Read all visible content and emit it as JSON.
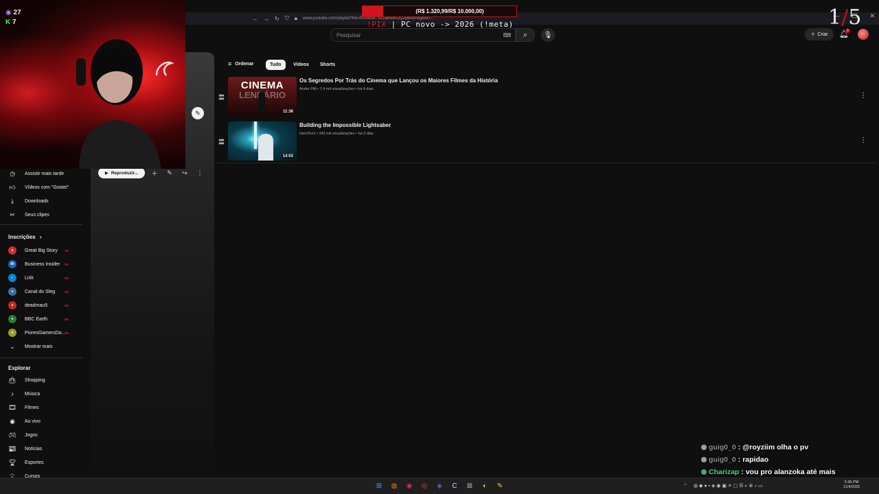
{
  "browser": {
    "url": "www.youtube.com/playlist?list=PLmiEw...cZ1avsuKOQZjwkWnxg8NU..."
  },
  "overlay": {
    "donation_text": "(R$ 1.320,99/R$ 10.000,00)",
    "pix_prefix": "!PIX",
    "pix_text": " | PC novo -> 2026 (!meta)",
    "counter_a": "1",
    "counter_b": "5",
    "viewer_count_a": "27",
    "viewer_count_b": "7"
  },
  "header": {
    "search_placeholder": "Pesquisar",
    "create_label": "Criar",
    "notifications_count": "9"
  },
  "filters": {
    "sort_label": "Ordenar",
    "chips": [
      "Tudo",
      "Vídeos",
      "Shorts"
    ]
  },
  "videos": [
    {
      "title": "Os Segredos Por Trás do Cinema que Lançou os Maiores Filmes da História",
      "meta": "Andre Pilli • 7,4 mil visualizações • há 4 dias",
      "duration": "11:36",
      "thumb_text": "CINEMA",
      "thumb_text2": "LENDÁRIO"
    },
    {
      "title": "Building the Impossible Lightsaber",
      "meta": "HeroTech • 342 mil visualizações • há 3 dias",
      "duration": "14:03"
    }
  ],
  "playlist": {
    "play_label": "Reproduzir..."
  },
  "sidebar": {
    "you_items": [
      {
        "label": "Assistir mais tarde",
        "icon": "clock-icon"
      },
      {
        "label": "Vídeos com \"Gostei\"",
        "icon": "thumbs-up-icon"
      },
      {
        "label": "Downloads",
        "icon": "download-icon"
      },
      {
        "label": "Seus clipes",
        "icon": "scissors-icon"
      }
    ],
    "subs_header": "Inscrições",
    "subscriptions": [
      {
        "label": "Great Big Story",
        "color": "#d32f2f",
        "initial": "●"
      },
      {
        "label": "Business Insider",
        "color": "#1565c0",
        "initial": "BI"
      },
      {
        "label": "Lirik",
        "color": "#0288d1",
        "initial": "◐"
      },
      {
        "label": "Canal do Sleg",
        "color": "#3d6fa8",
        "initial": "●"
      },
      {
        "label": "deadmau5",
        "color": "#c62828",
        "initial": "●"
      },
      {
        "label": "BBC Earth",
        "color": "#2e7d32",
        "initial": "●"
      },
      {
        "label": "PioresGamersDo...",
        "color": "#9e9d24",
        "initial": "●"
      }
    ],
    "show_more": "Mostrar mais",
    "explore_header": "Explorar",
    "explore": [
      {
        "label": "Shopping",
        "icon": "shopping-bag-icon"
      },
      {
        "label": "Música",
        "icon": "music-note-icon"
      },
      {
        "label": "Filmes",
        "icon": "film-icon"
      },
      {
        "label": "Ao vivo",
        "icon": "live-icon"
      },
      {
        "label": "Jogos",
        "icon": "gamepad-icon"
      },
      {
        "label": "Notícias",
        "icon": "news-icon"
      },
      {
        "label": "Esportes",
        "icon": "trophy-icon"
      },
      {
        "label": "Cursos",
        "icon": "lightbulb-icon"
      }
    ]
  },
  "chat": [
    {
      "user": "guig0_0",
      "message": "@royziim olha o pv"
    },
    {
      "user": "guig0_0",
      "message": "rapidao"
    },
    {
      "user": "Charizap",
      "message": "vou pro alanzoka até mais"
    }
  ],
  "taskbar": {
    "time": "5:36 PM",
    "date": "11/4/2025"
  }
}
